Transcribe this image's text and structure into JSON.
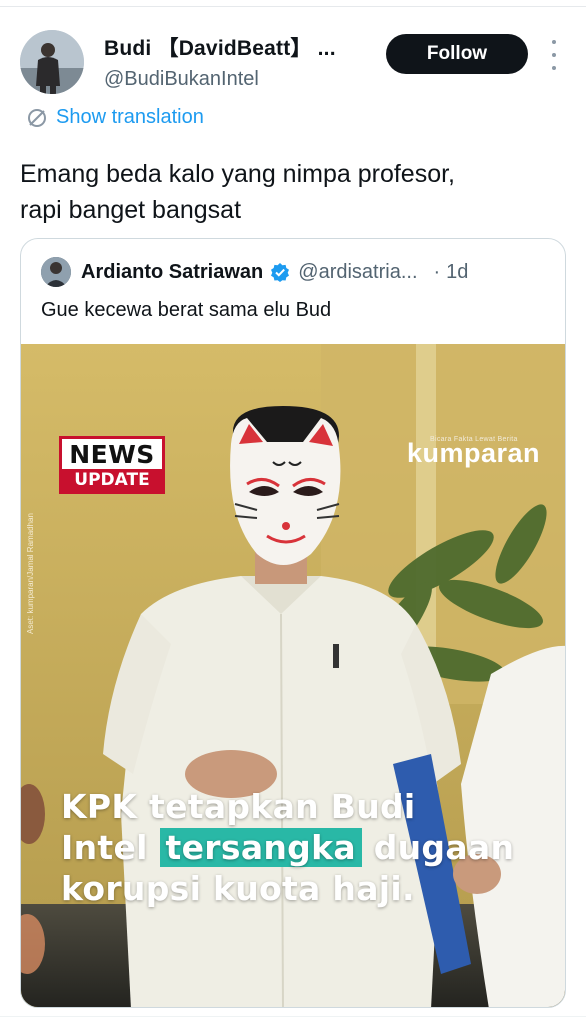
{
  "post": {
    "display_name": "Budi 【DavidBeatt】 ...",
    "handle": "@BudiBukanIntel",
    "follow_label": "Follow",
    "translate_label": "Show translation",
    "text_line1": "Emang beda kalo yang nimpa profesor,",
    "text_line2": "rapi banget bangsat"
  },
  "quote": {
    "name": "Ardianto Satriawan",
    "handle": "@ardisatria...",
    "separator": "·",
    "time": "1d",
    "text": "Gue kecewa berat sama elu Bud"
  },
  "media": {
    "badge_top": "NEWS",
    "badge_bottom": "UPDATE",
    "brand_tagline": "Bicara Fakta Lewat Berita",
    "brand": "kumparan",
    "credit": "Aset: kumparan/Jamal Ramadhan",
    "headline_line1": "KPK tetapkan Budi",
    "headline_line2_a": "Intel",
    "headline_line2_highlight": "tersangka",
    "headline_line2_b": "dugaan",
    "headline_line3": "korupsi kuota haji."
  },
  "colors": {
    "follow_bg": "#0f1419",
    "link_blue": "#1d9bf0",
    "verified_blue": "#1d9bf0",
    "news_red": "#c8102e",
    "highlight_teal": "#29b8a6"
  },
  "icons": [
    "more-vertical-icon",
    "translate-icon",
    "verified-badge-icon"
  ]
}
